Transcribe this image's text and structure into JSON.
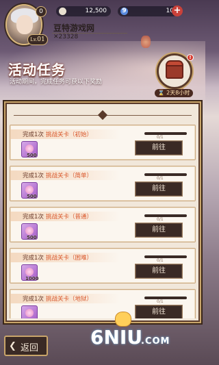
{
  "player": {
    "name": "豆特游戏网",
    "power": "✕23328",
    "level": "01",
    "vip": "0"
  },
  "resources": [
    {
      "icon": "coin-icon",
      "value": "12,500"
    },
    {
      "icon": "diamond-icon",
      "value": "10"
    }
  ],
  "page": {
    "title": "活动任务",
    "subtitle": "活动期间，完成任务可获以下奖励",
    "timer": "⌛ 2天8小时",
    "badge": "!"
  },
  "tasks": [
    {
      "count": "完成1次",
      "level": "挑战关卡（初始）",
      "progress": "0/1",
      "progress_fraction": 0,
      "reward": "500",
      "button": "前往"
    },
    {
      "count": "完成1次",
      "level": "挑战关卡（简单）",
      "progress": "0/1",
      "progress_fraction": 0,
      "reward": "500",
      "button": "前往"
    },
    {
      "count": "完成1次",
      "level": "挑战关卡（普通）",
      "progress": "0/1",
      "progress_fraction": 0,
      "reward": "500",
      "button": "前往"
    },
    {
      "count": "完成1次",
      "level": "挑战关卡（困难）",
      "progress": "0/1",
      "progress_fraction": 0,
      "reward": "1000",
      "button": "前往"
    },
    {
      "count": "完成1次",
      "level": "挑战关卡（地狱）",
      "progress": "0/1",
      "progress_fraction": 0,
      "reward": "",
      "button": "前往"
    }
  ],
  "footer": {
    "back_label": "返回",
    "watermark": "6NIU",
    "watermark_sub": ".COM"
  }
}
